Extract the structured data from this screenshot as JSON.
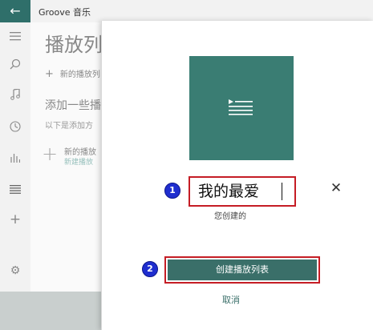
{
  "window": {
    "title": "Groove 音乐"
  },
  "nav": {
    "back_icon": "back-arrow-icon",
    "items": [
      "hamburger-icon",
      "search-icon",
      "music-note-icon",
      "recent-clock-icon",
      "charts-icon",
      "playlist-icon",
      "add-icon",
      "settings-icon"
    ]
  },
  "main": {
    "heading": "播放列",
    "new_playlist_label": "新的播放列",
    "add_some_heading": "添加一些播",
    "below_text": "以下是添加方",
    "new_playlist_card_title": "新的播放",
    "new_playlist_card_sub": "新建播放"
  },
  "dialog": {
    "name_input_value": "我的最爱",
    "owner_text": "您创建的",
    "create_button_label": "创建播放列表",
    "cancel_label": "取消",
    "step_badges": [
      "1",
      "2"
    ],
    "accent_color": "#3a7d73",
    "highlight_color": "#c51d25"
  }
}
